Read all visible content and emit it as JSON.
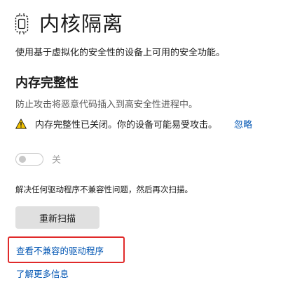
{
  "header": {
    "icon": "chip-icon",
    "title": "内核隔离"
  },
  "description": "使用基于虚拟化的安全性的设备上可用的安全功能。",
  "memory_integrity": {
    "title": "内存完整性",
    "description": "防止攻击将恶意代码插入到高安全性进程中。",
    "warning": {
      "icon": "warning-icon",
      "text": "内存完整性已关闭。你的设备可能易受攻击。",
      "ignore_label": "忽略"
    },
    "toggle": {
      "state_label": "关",
      "on": false,
      "disabled": true
    },
    "resolve_text": "解决任何驱动程序不兼容性问题，然后再次扫描。",
    "rescan_label": "重新扫描",
    "incompatible_link": "查看不兼容的驱动程序",
    "learn_more_link": "了解更多信息"
  },
  "colors": {
    "link": "#0055b3",
    "highlight_border": "#e02a2a",
    "warning_yellow": "#f2c200",
    "button_bg": "#e0e0e0"
  }
}
